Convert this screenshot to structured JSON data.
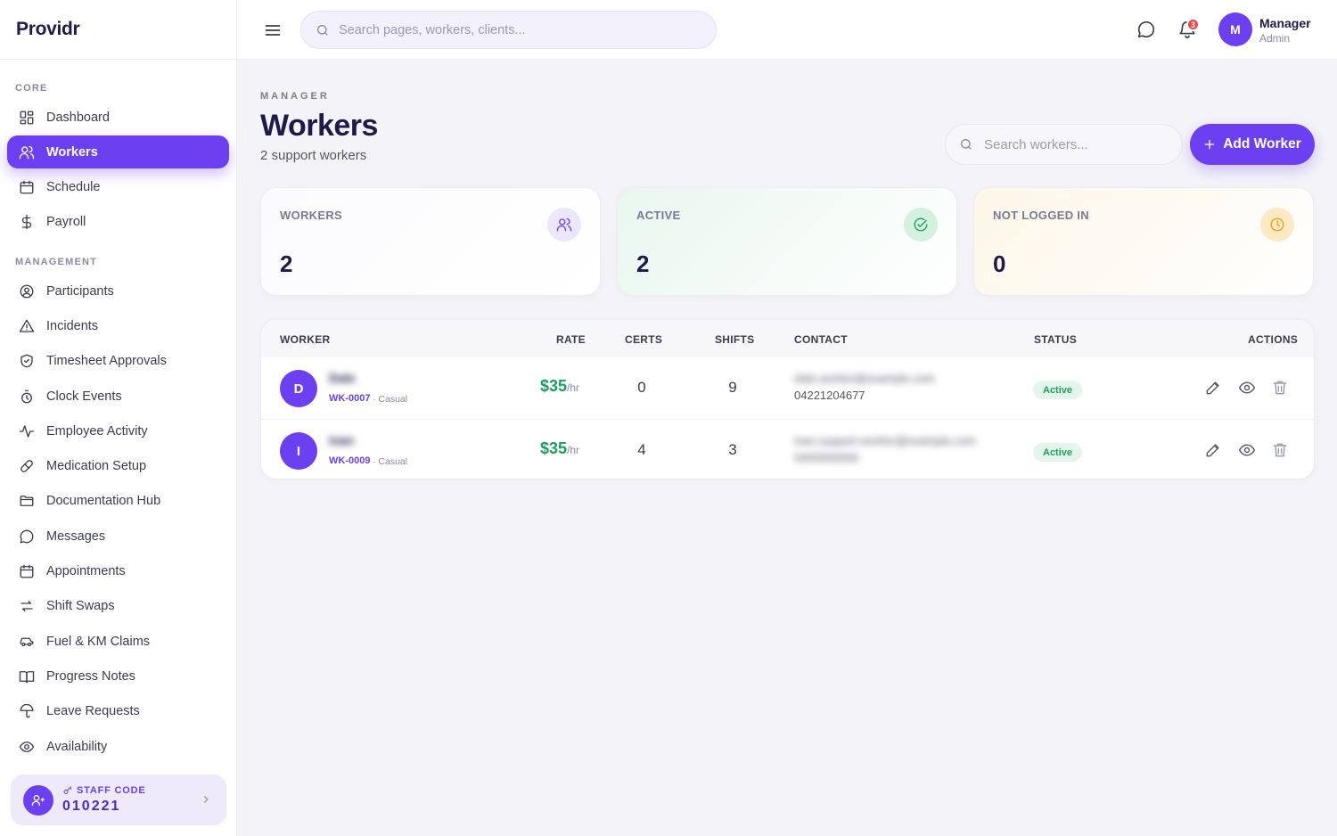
{
  "brand": "Providr",
  "sidebar": {
    "sections": [
      {
        "label": "CORE",
        "items": [
          {
            "label": "Dashboard",
            "icon": "dashboard-icon"
          },
          {
            "label": "Workers",
            "icon": "users-icon",
            "active": true
          },
          {
            "label": "Schedule",
            "icon": "calendar-icon"
          },
          {
            "label": "Payroll",
            "icon": "dollar-icon"
          }
        ]
      },
      {
        "label": "MANAGEMENT",
        "items": [
          {
            "label": "Participants",
            "icon": "user-circle-icon"
          },
          {
            "label": "Incidents",
            "icon": "warning-icon"
          },
          {
            "label": "Timesheet Approvals",
            "icon": "shield-check-icon"
          },
          {
            "label": "Clock Events",
            "icon": "stopwatch-icon"
          },
          {
            "label": "Employee Activity",
            "icon": "activity-icon"
          },
          {
            "label": "Medication Setup",
            "icon": "pill-icon"
          },
          {
            "label": "Documentation Hub",
            "icon": "folder-icon"
          },
          {
            "label": "Messages",
            "icon": "message-icon"
          },
          {
            "label": "Appointments",
            "icon": "calendar-icon"
          },
          {
            "label": "Shift Swaps",
            "icon": "swap-icon"
          },
          {
            "label": "Fuel & KM Claims",
            "icon": "car-icon"
          },
          {
            "label": "Progress Notes",
            "icon": "book-icon"
          },
          {
            "label": "Leave Requests",
            "icon": "umbrella-icon"
          },
          {
            "label": "Availability",
            "icon": "eye-icon"
          }
        ]
      }
    ],
    "staff_code": {
      "label": "STAFF CODE",
      "code": "010221"
    }
  },
  "topbar": {
    "search_placeholder": "Search pages, workers, clients...",
    "notification_count": "3",
    "user": {
      "initial": "M",
      "name": "Manager",
      "role": "Admin"
    }
  },
  "page": {
    "eyebrow": "MANAGER",
    "title": "Workers",
    "subtitle": "2 support workers",
    "search_placeholder": "Search workers...",
    "add_label": "Add Worker"
  },
  "stats": [
    {
      "label": "WORKERS",
      "value": "2"
    },
    {
      "label": "ACTIVE",
      "value": "2"
    },
    {
      "label": "NOT LOGGED IN",
      "value": "0"
    }
  ],
  "table": {
    "columns": {
      "worker": "WORKER",
      "rate": "RATE",
      "certs": "CERTS",
      "shifts": "SHIFTS",
      "contact": "CONTACT",
      "status": "STATUS",
      "actions": "ACTIONS"
    },
    "rows": [
      {
        "initial": "D",
        "name": "Dale",
        "id": "WK-0007",
        "type": "· Casual",
        "rate": "$35",
        "rate_unit": "/hr",
        "certs": "0",
        "shifts": "9",
        "email": "dale.worker@example.com",
        "phone": "04221204677",
        "status": "Active"
      },
      {
        "initial": "I",
        "name": "Ivan",
        "id": "WK-0009",
        "type": "· Casual",
        "rate": "$35",
        "rate_unit": "/hr",
        "certs": "4",
        "shifts": "3",
        "email": "ivan.support.worker@example.com",
        "phone": "0400000000",
        "status": "Active"
      }
    ]
  },
  "colors": {
    "accent": "#6c3ff0",
    "success": "#1a9e5e",
    "warning": "#f59e0b",
    "danger": "#ef4444"
  }
}
